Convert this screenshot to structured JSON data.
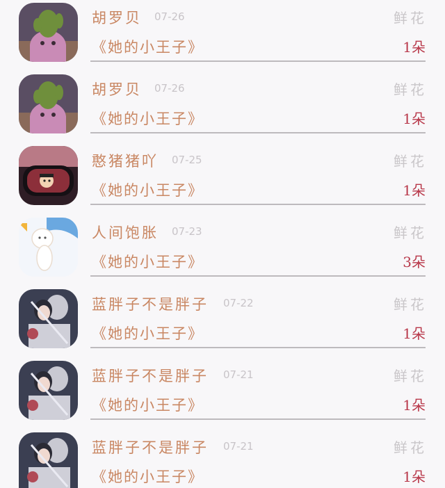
{
  "records": [
    {
      "name": "胡罗贝",
      "date": "07-26",
      "gift": "《她的小王子》",
      "type": "鲜花",
      "count": "1朵",
      "avatar": "cactus-ghost-avatar"
    },
    {
      "name": "胡罗贝",
      "date": "07-26",
      "gift": "《她的小王子》",
      "type": "鲜花",
      "count": "1朵",
      "avatar": "cactus-ghost-avatar"
    },
    {
      "name": "憨猪猪吖",
      "date": "07-25",
      "gift": "《她的小王子》",
      "type": "鲜花",
      "count": "1朵",
      "avatar": "mirror-cartoon-avatar"
    },
    {
      "name": "人间饱胀",
      "date": "07-23",
      "gift": "《她的小王子》",
      "type": "鲜花",
      "count": "3朵",
      "avatar": "white-doll-avatar"
    },
    {
      "name": "蓝胖子不是胖子",
      "date": "07-22",
      "gift": "《她的小王子》",
      "type": "鲜花",
      "count": "1朵",
      "avatar": "couple-illustration-avatar"
    },
    {
      "name": "蓝胖子不是胖子",
      "date": "07-21",
      "gift": "《她的小王子》",
      "type": "鲜花",
      "count": "1朵",
      "avatar": "couple-illustration-avatar"
    },
    {
      "name": "蓝胖子不是胖子",
      "date": "07-21",
      "gift": "《她的小王子》",
      "type": "鲜花",
      "count": "1朵",
      "avatar": "couple-illustration-avatar"
    }
  ]
}
